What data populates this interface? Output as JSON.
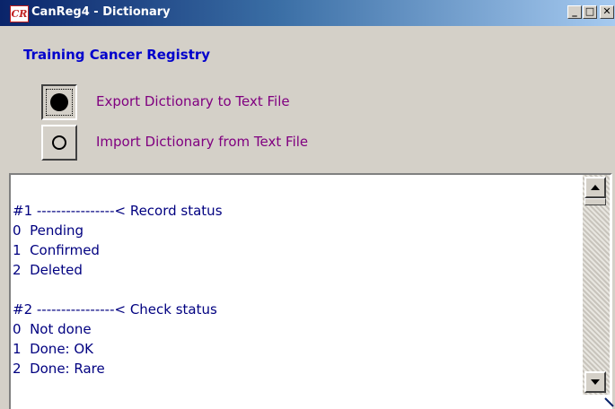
{
  "window": {
    "title": "CanReg4 - Dictionary",
    "icon_text": "CR",
    "controls": {
      "minimize": "_",
      "maximize": "□",
      "close": "✕"
    }
  },
  "registry_title": "Training Cancer Registry",
  "actions": {
    "export_label": "Export Dictionary to Text File",
    "import_label": "Import Dictionary from Text File",
    "selected": "export"
  },
  "dictionary_lines": [
    "#1 ----------------< Record status",
    "0  Pending",
    "1  Confirmed",
    "2  Deleted",
    "",
    "#2 ----------------< Check status",
    "0  Not done",
    "1  Done: OK",
    "2  Done: Rare"
  ],
  "colors": {
    "title_text": "#0000cc",
    "button_label": "#800080",
    "dictionary_text": "#000080"
  }
}
